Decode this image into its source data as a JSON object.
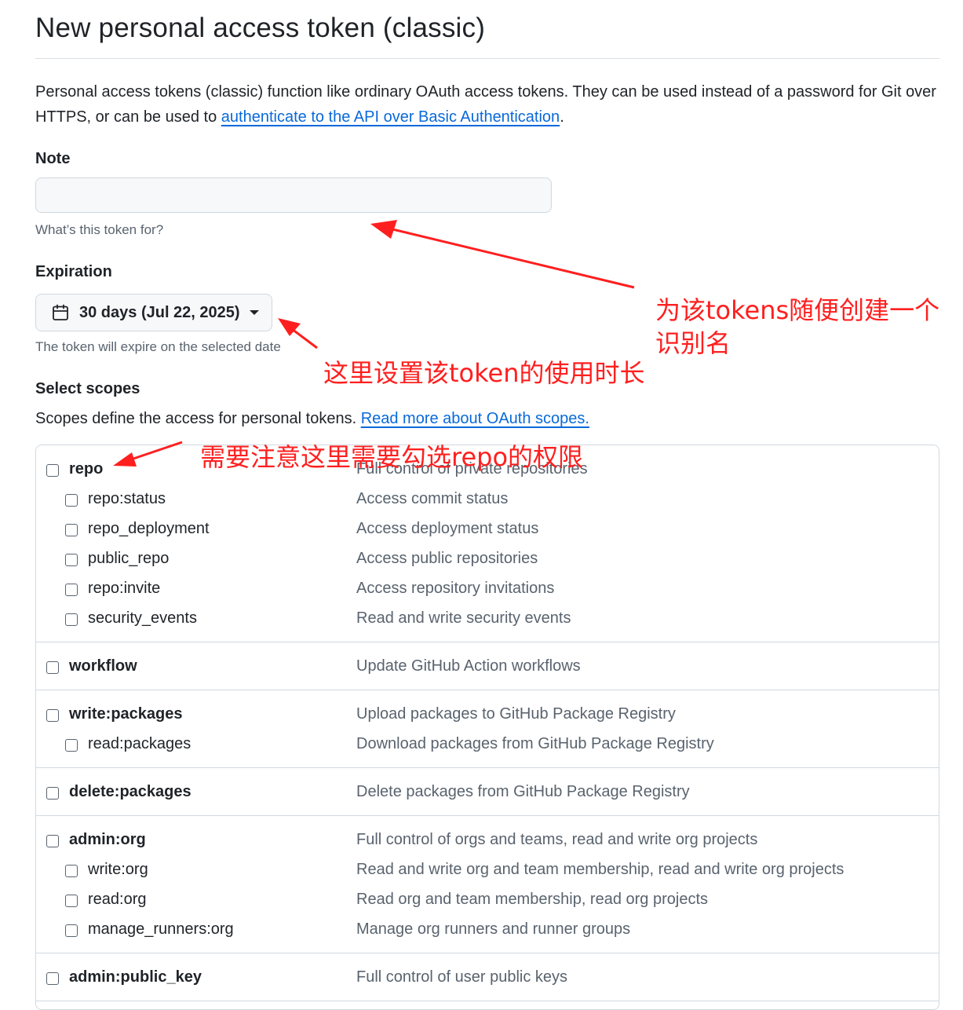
{
  "page_title": "New personal access token (classic)",
  "intro": {
    "text_before": "Personal access tokens (classic) function like ordinary OAuth access tokens. They can be used instead of a password for Git over HTTPS, or can be used to ",
    "link": "authenticate to the API over Basic Authentication",
    "text_after": "."
  },
  "note": {
    "label": "Note",
    "value": "",
    "placeholder": "",
    "hint": "What’s this token for?"
  },
  "expiration": {
    "label": "Expiration",
    "selected": "30 days (Jul 22, 2025)",
    "hint": "The token will expire on the selected date"
  },
  "scopes": {
    "label": "Select scopes",
    "desc": "Scopes define the access for personal tokens. ",
    "link": "Read more about OAuth scopes.",
    "groups": [
      {
        "main": {
          "name": "repo",
          "desc": "Full control of private repositories"
        },
        "subs": [
          {
            "name": "repo:status",
            "desc": "Access commit status"
          },
          {
            "name": "repo_deployment",
            "desc": "Access deployment status"
          },
          {
            "name": "public_repo",
            "desc": "Access public repositories"
          },
          {
            "name": "repo:invite",
            "desc": "Access repository invitations"
          },
          {
            "name": "security_events",
            "desc": "Read and write security events"
          }
        ]
      },
      {
        "main": {
          "name": "workflow",
          "desc": "Update GitHub Action workflows"
        },
        "subs": []
      },
      {
        "main": {
          "name": "write:packages",
          "desc": "Upload packages to GitHub Package Registry"
        },
        "subs": [
          {
            "name": "read:packages",
            "desc": "Download packages from GitHub Package Registry"
          }
        ]
      },
      {
        "main": {
          "name": "delete:packages",
          "desc": "Delete packages from GitHub Package Registry"
        },
        "subs": []
      },
      {
        "main": {
          "name": "admin:org",
          "desc": "Full control of orgs and teams, read and write org projects"
        },
        "subs": [
          {
            "name": "write:org",
            "desc": "Read and write org and team membership, read and write org projects"
          },
          {
            "name": "read:org",
            "desc": "Read org and team membership, read org projects"
          },
          {
            "name": "manage_runners:org",
            "desc": "Manage org runners and runner groups"
          }
        ]
      },
      {
        "main": {
          "name": "admin:public_key",
          "desc": "Full control of user public keys"
        },
        "subs": []
      }
    ]
  },
  "annotations": {
    "note_annot_line1": "为该tokens随便创建一个",
    "note_annot_line2": "识别名",
    "expiration_annot": "这里设置该token的使用时长",
    "repo_annot": "需要注意这里需要勾选repo的权限"
  },
  "colors": {
    "annotation": "#ff1f1f",
    "link": "#0969da"
  }
}
